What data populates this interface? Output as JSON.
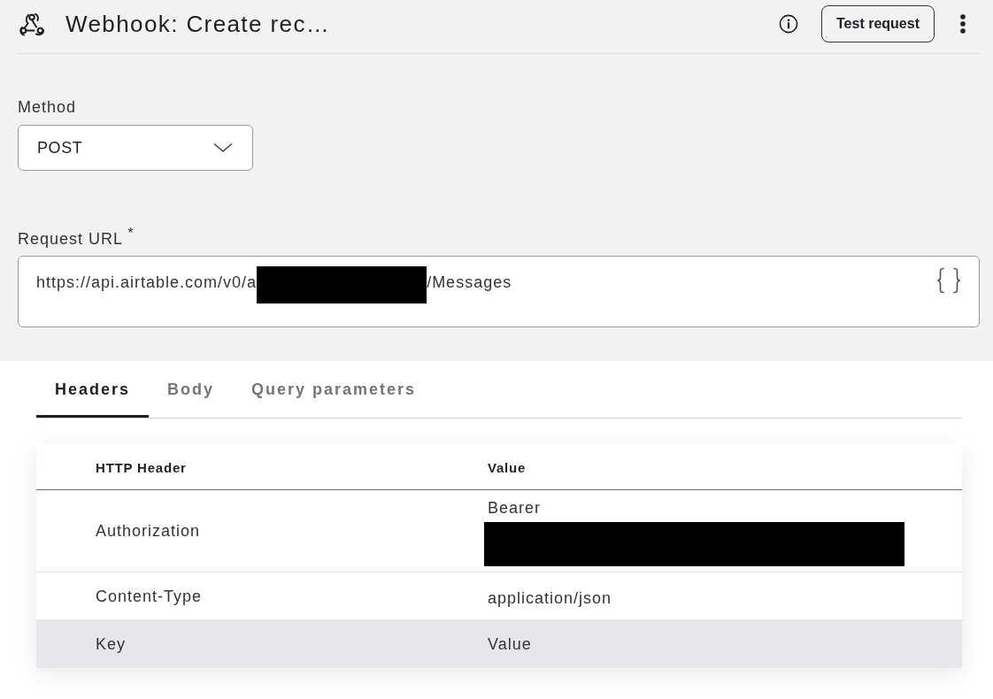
{
  "header": {
    "title": "Webhook: Create rec…",
    "action_button": "Test request"
  },
  "method": {
    "label": "Method",
    "value": "POST"
  },
  "request_url": {
    "label": "Request URL $^{*}$",
    "value_parts": [
      {
        "kind": "text",
        "text": "https://api.airtable.com/v0/a"
      },
      {
        "kind": "redacted"
      },
      {
        "kind": "text",
        "text": "/Messages"
      }
    ]
  },
  "tabs": [
    {
      "label": "Headers",
      "selected": true
    },
    {
      "label": "Body",
      "selected": false
    },
    {
      "label": "Query parameters",
      "selected": false
    }
  ],
  "table": {
    "columns": [
      "HTTP Header",
      "Value"
    ],
    "rows": [
      {
        "key": "Authorization",
        "value_parts": [
          {
            "kind": "text",
            "text": "Bearer"
          },
          {
            "kind": "redacted"
          }
        ]
      },
      {
        "key": "Content-Type",
        "value_parts": [
          {
            "kind": "text",
            "text": "application/json"
          }
        ]
      }
    ],
    "new_row": {
      "highlighted": true,
      "key": {
        "placeholder": "Key"
      },
      "value": {
        "placeholder": "Value"
      }
    }
  }
}
